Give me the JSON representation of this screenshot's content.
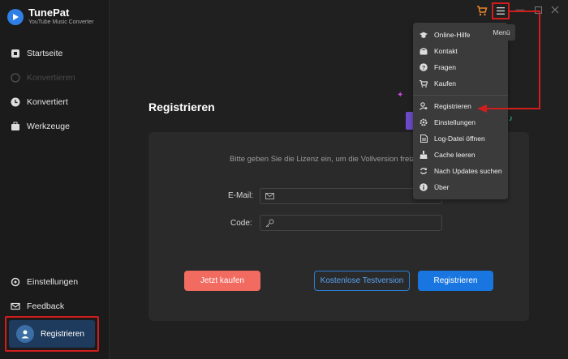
{
  "app": {
    "name": "TunePat",
    "subtitle": "YouTube Music Converter"
  },
  "sidebar": {
    "items": [
      {
        "label": "Startseite",
        "icon": "home-icon"
      },
      {
        "label": "Konvertieren",
        "icon": "convert-icon"
      },
      {
        "label": "Konvertiert",
        "icon": "clock-icon"
      },
      {
        "label": "Werkzeuge",
        "icon": "toolbox-icon"
      }
    ],
    "bottom": [
      {
        "label": "Einstellungen",
        "icon": "gear-icon"
      },
      {
        "label": "Feedback",
        "icon": "mail-icon"
      }
    ],
    "register_label": "Registrieren"
  },
  "main": {
    "title": "Registrieren",
    "hint": "Bitte geben Sie die Lizenz ein, um die Vollversion freiz",
    "email_label": "E-Mail:",
    "code_label": "Code:",
    "buy_label": "Jetzt kaufen",
    "trial_label": "Kostenlose Testversion",
    "register_label": "Registrieren"
  },
  "topbar": {
    "tooltip": "Menü"
  },
  "menu": {
    "items": [
      {
        "label": "Online-Hilfe",
        "icon": "graduation-cap-icon"
      },
      {
        "label": "Kontakt",
        "icon": "phone-icon"
      },
      {
        "label": "Fragen",
        "icon": "question-icon"
      },
      {
        "label": "Kaufen",
        "icon": "cart-icon"
      },
      {
        "label": "Registrieren",
        "icon": "user-key-icon"
      },
      {
        "label": "Einstellungen",
        "icon": "gear-icon"
      },
      {
        "label": "Log-Datei öffnen",
        "icon": "file-icon"
      },
      {
        "label": "Cache leeren",
        "icon": "broom-icon"
      },
      {
        "label": "Nach Updates suchen",
        "icon": "refresh-icon"
      },
      {
        "label": "Über",
        "icon": "info-icon"
      }
    ]
  },
  "colors": {
    "accent": "#1976e0",
    "highlight": "#d21d1d",
    "buy": "#f26b61"
  }
}
